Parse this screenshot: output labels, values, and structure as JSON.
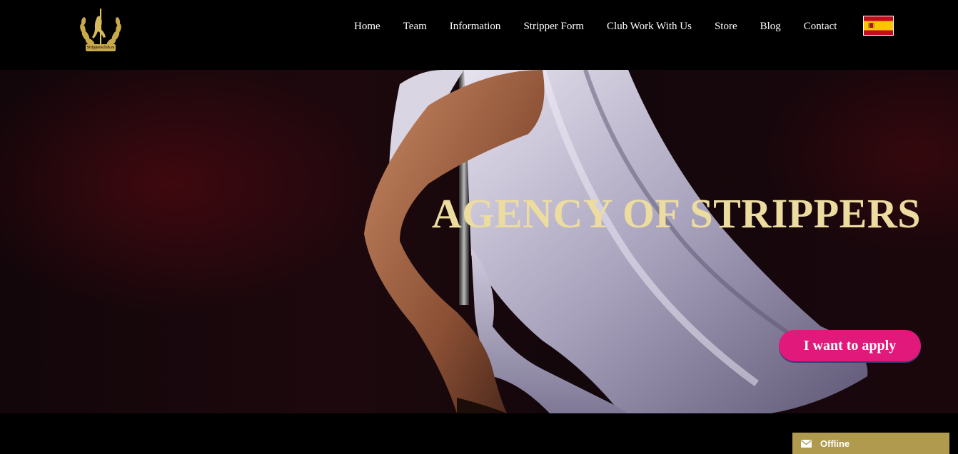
{
  "header": {
    "logo_text": "Strippersclub.es",
    "nav": [
      {
        "label": "Home"
      },
      {
        "label": "Team"
      },
      {
        "label": "Information"
      },
      {
        "label": "Stripper Form"
      },
      {
        "label": "Club Work With Us"
      },
      {
        "label": "Store"
      },
      {
        "label": "Blog"
      },
      {
        "label": "Contact"
      }
    ],
    "language_flag": "spain-flag-icon"
  },
  "hero": {
    "title": "AGENCY OF STRIPPERS",
    "cta_label": "I want to apply"
  },
  "chat_widget": {
    "status_label": "Offline",
    "icon": "envelope-icon"
  },
  "colors": {
    "title_gold": "#ecdca0",
    "cta_pink": "#e1197b",
    "chat_gold": "#b09a4d"
  }
}
